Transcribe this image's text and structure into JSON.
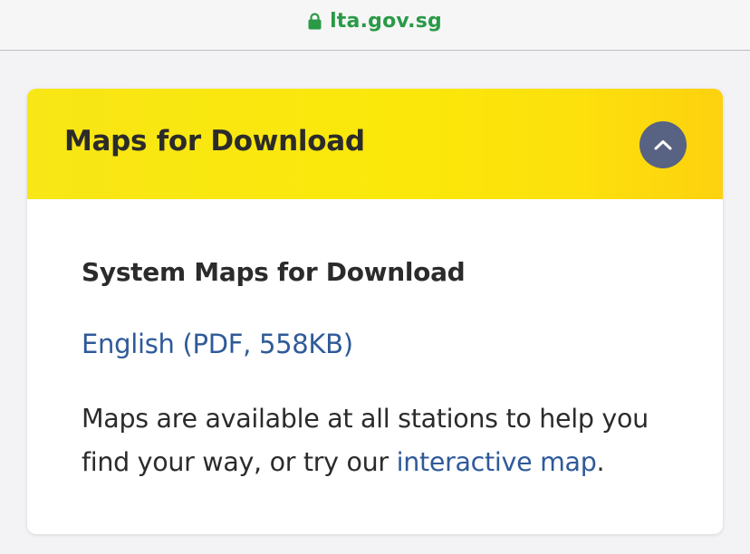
{
  "browser": {
    "url": "lta.gov.sg",
    "url_color": "#2a9a47"
  },
  "icons": {
    "lock": "lock-icon",
    "collapse": "chevron-up-icon"
  },
  "accordion": {
    "title": "Maps for Download",
    "expanded": true,
    "header_color": "#fbe80a",
    "button_color": "#586283"
  },
  "content": {
    "section_title": "System Maps for Download",
    "download_link": "English (PDF, 558KB)",
    "description_part1": "Maps are available at all stations to help you find your way, or try our ",
    "description_link": "interactive map",
    "description_part2": ".",
    "link_color": "#2f5a99"
  }
}
